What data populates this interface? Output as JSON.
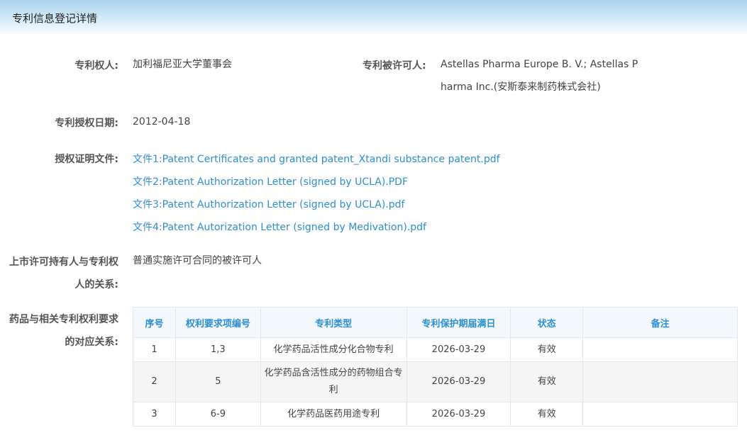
{
  "header": {
    "title": "专利信息登记详情"
  },
  "fields": {
    "patentee_label": "专利权人:",
    "patentee_value": "加利福尼亚大学董事会",
    "licensee_label": "专利被许可人:",
    "licensee_value_line1": "Astellas Pharma Europe B. V.; Astellas P",
    "licensee_value_line2": "harma Inc.(安斯泰来制药株式会社)",
    "grant_date_label": "专利授权日期:",
    "grant_date_value": "2012-04-18",
    "cert_label": "授权证明文件:",
    "cert_files": [
      "文件1:Patent Certificates and granted patent_Xtandi substance patent.pdf",
      "文件2:Patent Authorization Letter (signed by UCLA).PDF",
      "文件3:Patent Authorization Letter (signed by UCLA).pdf",
      "文件4:Patent Autorization Letter (signed by Medivation).pdf"
    ],
    "relation_label_line1": "上市许可持有人与专利权",
    "relation_label_line2": "人的关系:",
    "relation_value": "普通实施许可合同的被许可人",
    "mapping_label_line1": "药品与相关专利权利要求",
    "mapping_label_line2": "的对应关系:"
  },
  "table": {
    "headers": [
      "序号",
      "权利要求项编号",
      "专利类型",
      "专利保护期届满日",
      "状态",
      "备注"
    ],
    "rows": [
      [
        "1",
        "1,3",
        "化学药品活性成分化合物专利",
        "2026-03-29",
        "有效",
        ""
      ],
      [
        "2",
        "5",
        "化学药品含活性成分的药物组合专利",
        "2026-03-29",
        "有效",
        ""
      ],
      [
        "3",
        "6-9",
        "化学药品医药用途专利",
        "2026-03-29",
        "有效",
        ""
      ]
    ]
  }
}
